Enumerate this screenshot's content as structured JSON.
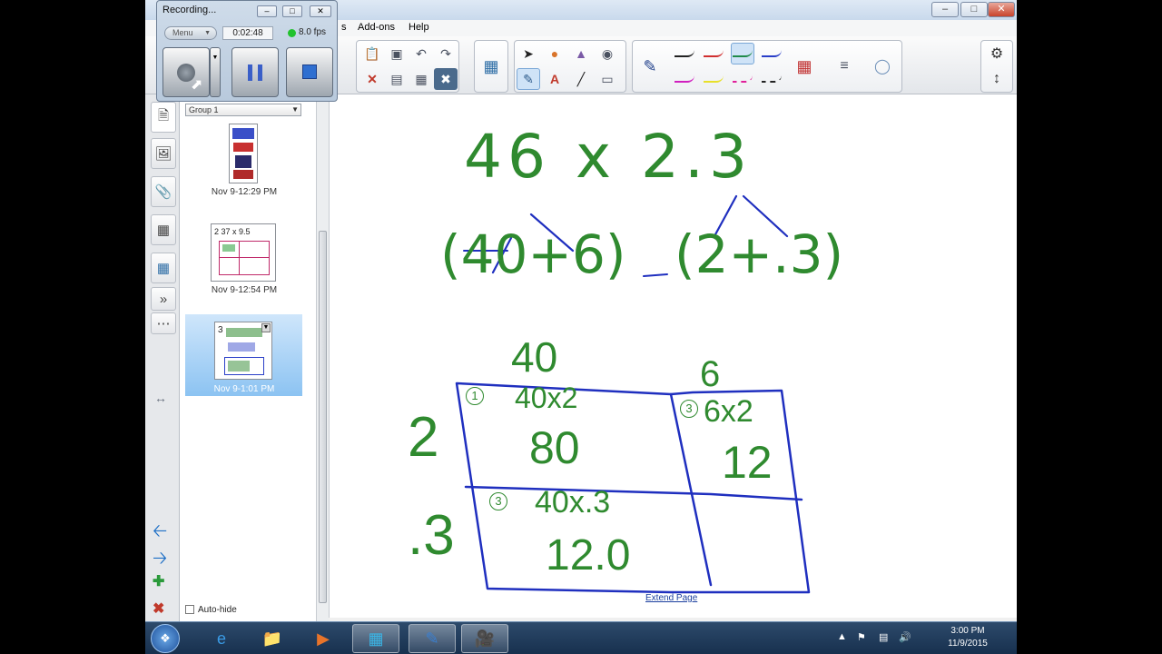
{
  "app": {
    "menu": [
      "s",
      "Add-ons",
      "Help"
    ],
    "window_controls": [
      "minimize",
      "maximize",
      "close"
    ]
  },
  "recorder": {
    "title": "Recording...",
    "menu_label": "Menu",
    "elapsed": "0:02:48",
    "fps": "8.0 fps",
    "status_color": "#22c22e"
  },
  "sorter": {
    "group": "Group 1",
    "pages": [
      {
        "label": "Nov 9-12:29 PM"
      },
      {
        "label": "Nov 9-12:54 PM",
        "preview_text": "2  37 x 9.5"
      },
      {
        "label": "Nov 9-1:01 PM",
        "preview_text": "3",
        "selected": true
      }
    ],
    "auto_hide_label": "Auto-hide"
  },
  "canvas": {
    "header_problem": [
      "46 x 2.3"
    ],
    "left_decomposition": "(40+6)",
    "right_decomposition": "(2+.3)",
    "column_labels": [
      "40",
      "6"
    ],
    "row_labels": [
      "2",
      ".3"
    ],
    "cells": [
      {
        "step": "1",
        "expression": "40x2",
        "result": "80"
      },
      {
        "step": "3",
        "expression": "6x2",
        "result": "12"
      },
      {
        "step": "3",
        "expression": "40x.3",
        "result": "12.0"
      },
      {
        "step": "",
        "expression": "",
        "result": ""
      }
    ],
    "extend_link": "Extend Page"
  },
  "taskbar": {
    "time": "3:00 PM",
    "date": "11/9/2015"
  },
  "colors": {
    "ink_green": "#2f8a2f",
    "ink_blue": "#1f2fbf",
    "title_bar": "#c9d9ec",
    "taskbar": "#17304e"
  }
}
